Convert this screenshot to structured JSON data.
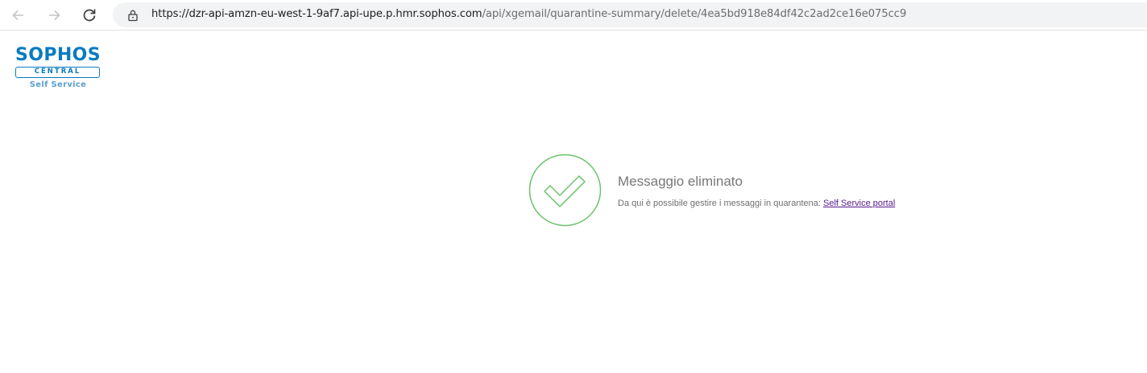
{
  "browser": {
    "url_host": "https://dzr-api-amzn-eu-west-1-9af7.api-upe.p.hmr.sophos.com",
    "url_path": "/api/xgemail/quarantine-summary/delete/4ea5bd918e84df42c2ad2ce16e075cc9",
    "icons": {
      "back": "arrow-left-icon",
      "forward": "arrow-right-icon",
      "reload": "reload-icon",
      "site_info": "lock-icon"
    }
  },
  "logo": {
    "brand": "SOPHOS",
    "product": "CENTRAL",
    "subtitle": "Self Service",
    "color": "#0a7bc1"
  },
  "result": {
    "icon": "check-circle-icon",
    "icon_color": "#6cc26a",
    "title": "Messaggio eliminato",
    "description": "Da qui è possibile gestire i messaggi in quarantena:",
    "link_label": "Self Service portal"
  }
}
